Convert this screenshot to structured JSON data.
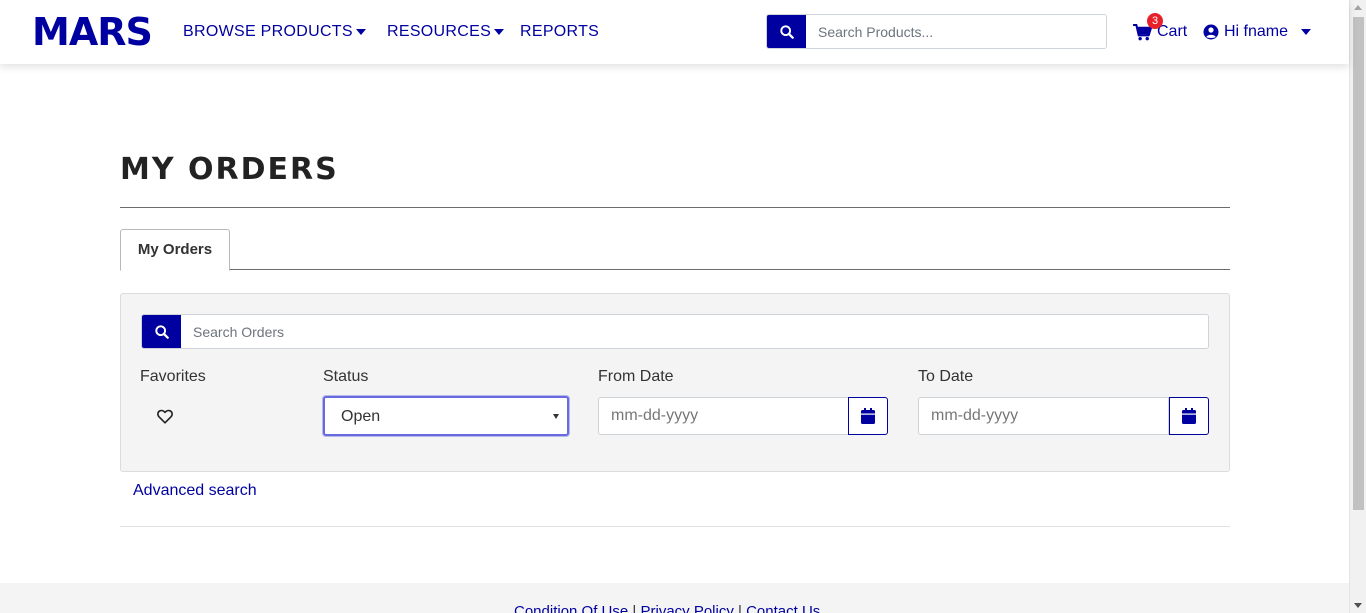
{
  "header": {
    "logo": "MARS",
    "nav": [
      {
        "label": "BROWSE PRODUCTS",
        "has_dropdown": true
      },
      {
        "label": "RESOURCES",
        "has_dropdown": true
      },
      {
        "label": "REPORTS",
        "has_dropdown": false
      }
    ],
    "search_placeholder": "Search Products...",
    "cart_label": "Cart",
    "cart_count": "3",
    "user_greeting": "Hi fname"
  },
  "main": {
    "page_title": "MY ORDERS",
    "tabs": [
      {
        "label": "My Orders",
        "active": true
      }
    ],
    "filters": {
      "search_placeholder": "Search Orders",
      "favorites_label": "Favorites",
      "status_label": "Status",
      "status_value": "Open",
      "from_date_label": "From Date",
      "from_date_placeholder": "mm-dd-yyyy",
      "to_date_label": "To Date",
      "to_date_placeholder": "mm-dd-yyyy"
    },
    "advanced_search": "Advanced search"
  },
  "footer": {
    "links": [
      "Condition Of Use",
      "Privacy Policy",
      "Contact Us"
    ]
  },
  "colors": {
    "brand": "#0000a0",
    "badge": "#e8202a",
    "panel_bg": "#f4f4f4"
  },
  "icons": {
    "search": "search-icon",
    "cart": "cart-icon",
    "user": "user-circle-icon",
    "favorite": "heart-icon",
    "calendar": "calendar-icon"
  }
}
